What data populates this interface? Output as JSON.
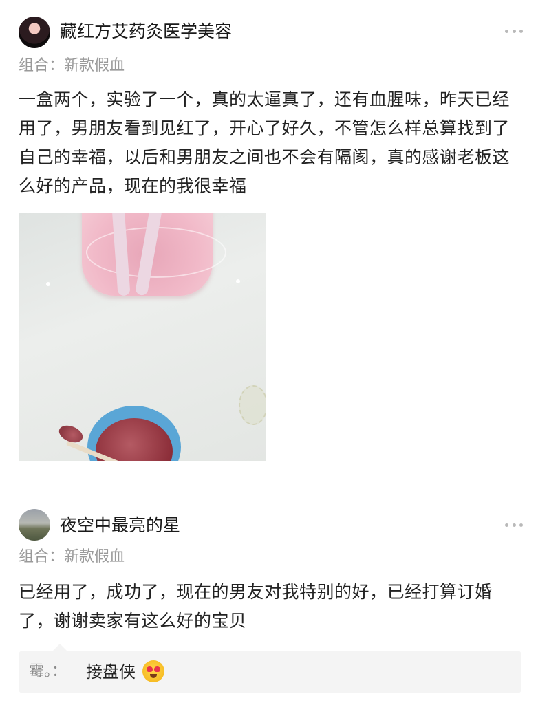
{
  "reviews": [
    {
      "username": "藏红方艾药灸医学美容",
      "sku": "组合：新款假血",
      "content": "一盒两个，实验了一个，真的太逼真了，还有血腥味，昨天已经用了，男朋友看到见红了，开心了好久，不管怎么样总算找到了自己的幸福，以后和男朋友之间也不会有隔阂，真的感谢老板这么好的产品，现在的我很幸福"
    },
    {
      "username": "夜空中最亮的星",
      "sku": "组合：新款假血",
      "content": "已经用了，成功了，现在的男友对我特别的好，已经打算订婚了，谢谢卖家有这么好的宝贝",
      "reply": {
        "name": "霉。：",
        "text": "接盘侠"
      }
    }
  ],
  "icons": {
    "more": "more-dots-icon",
    "emoji": "heart-eyes-emoji-icon"
  }
}
